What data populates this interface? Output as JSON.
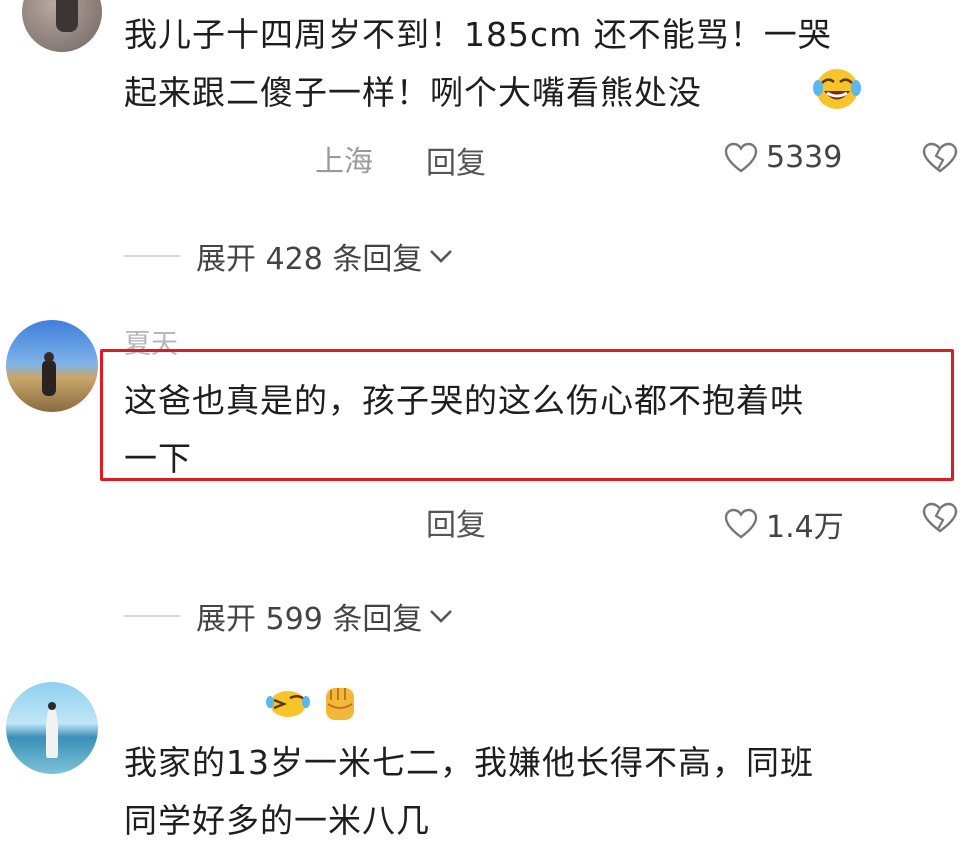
{
  "comments": [
    {
      "text_lines": [
        "我儿子十四周岁不到！185cm 还不能骂！一哭",
        "起来跟二傻子一样！咧个大嘴看熊处没"
      ],
      "location": "上海",
      "reply_label": "回复",
      "likes": "5339",
      "expand_label": "展开 428 条回复"
    },
    {
      "username": "夏天",
      "text_lines": [
        "这爸也真是的，孩子哭的这么伤心都不抱着哄",
        "一下"
      ],
      "reply_label": "回复",
      "likes": "1.4万",
      "expand_label": "展开 599 条回复"
    },
    {
      "text_lines": [
        "我家的13岁一米七二，我嫌他长得不高，同班",
        "同学好多的一米八几"
      ]
    }
  ],
  "colors": {
    "highlight_border": "#e01a22",
    "icon_stroke": "#777777"
  },
  "icons": {
    "like": "heart-outline-icon",
    "dislike": "broken-heart-icon",
    "expand": "chevron-down-icon",
    "emoji_laugh": "laughing-tears-emoji",
    "emoji_fist": "raised-fist-emoji"
  }
}
